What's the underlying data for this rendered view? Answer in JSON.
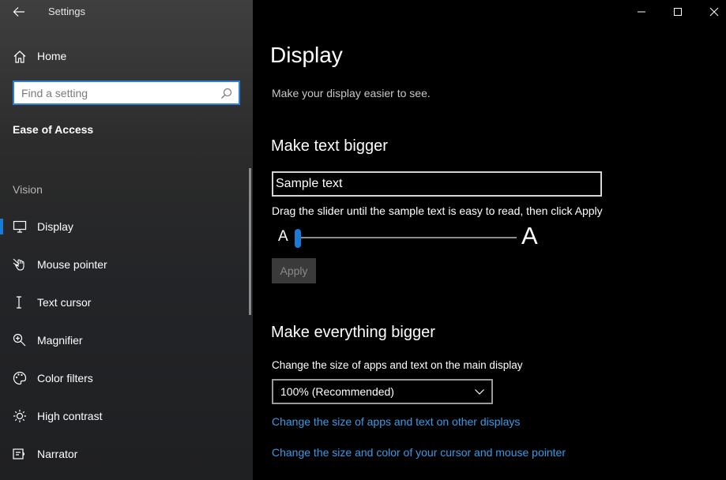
{
  "app": {
    "title": "Settings"
  },
  "sidebar": {
    "home_label": "Home",
    "search_placeholder": "Find a setting",
    "section_title": "Ease of Access",
    "group_label": "Vision",
    "items": [
      {
        "label": "Display",
        "icon": "monitor-icon",
        "active": true
      },
      {
        "label": "Mouse pointer",
        "icon": "mouse-pointer-icon"
      },
      {
        "label": "Text cursor",
        "icon": "text-cursor-icon"
      },
      {
        "label": "Magnifier",
        "icon": "magnifier-icon"
      },
      {
        "label": "Color filters",
        "icon": "palette-icon"
      },
      {
        "label": "High contrast",
        "icon": "sun-icon"
      },
      {
        "label": "Narrator",
        "icon": "narrator-icon"
      }
    ]
  },
  "main": {
    "title": "Display",
    "subtitle": "Make your display easier to see.",
    "text_bigger": {
      "heading": "Make text bigger",
      "sample_text": "Sample text",
      "hint": "Drag the slider until the sample text is easy to read, then click Apply",
      "small_a": "A",
      "large_a": "A",
      "slider_value": 0,
      "apply_label": "Apply"
    },
    "everything_bigger": {
      "heading": "Make everything bigger",
      "label": "Change the size of apps and text on the main display",
      "selected": "100% (Recommended)",
      "link_other_displays": "Change the size of apps and text on other displays",
      "link_cursor": "Change the size and color of your cursor and mouse pointer"
    }
  },
  "colors": {
    "accent": "#1b7ad6",
    "link": "#3a9ae8",
    "background": "#000000"
  }
}
